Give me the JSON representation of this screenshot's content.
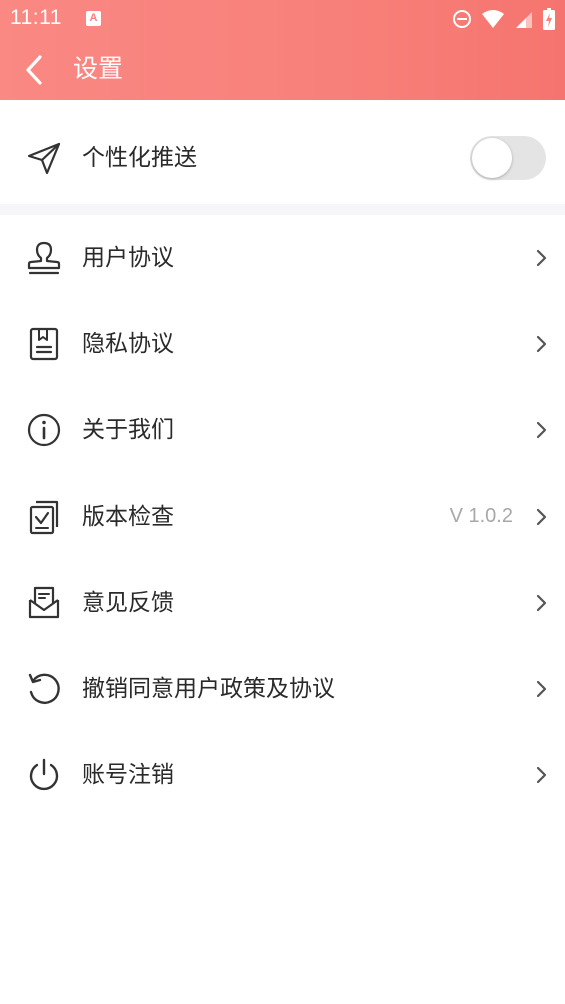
{
  "status_bar": {
    "time": "11:11",
    "app_icon_letter": "A"
  },
  "header": {
    "title": "设置",
    "gradient": [
      "#fa8883",
      "#f6746f"
    ]
  },
  "push_setting": {
    "label": "个性化推送",
    "enabled": false
  },
  "menu_items": [
    {
      "label": "用户协议",
      "icon": "user-stamp-icon",
      "value": ""
    },
    {
      "label": "隐私协议",
      "icon": "document-icon",
      "value": ""
    },
    {
      "label": "关于我们",
      "icon": "info-icon",
      "value": ""
    },
    {
      "label": "版本检查",
      "icon": "version-check-icon",
      "value": "V 1.0.2"
    },
    {
      "label": "意见反馈",
      "icon": "feedback-mail-icon",
      "value": ""
    },
    {
      "label": "撤销同意用户政策及协议",
      "icon": "revoke-icon",
      "value": ""
    },
    {
      "label": "账号注销",
      "icon": "power-icon",
      "value": ""
    }
  ]
}
